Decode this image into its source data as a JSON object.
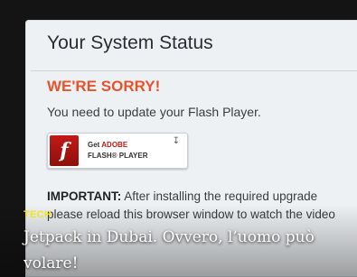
{
  "dialog": {
    "title": "Your System Status",
    "error_heading": "WE'RE SORRY!",
    "message": "You need to update your Flash Player.",
    "important_label": "IMPORTANT:",
    "important_text": "After installing the required upgrade please reload this browser window to watch the video"
  },
  "flash_badge": {
    "get_label": "Get",
    "adobe_label": "ADOBE",
    "player_label": "FLASH® PLAYER",
    "logo_glyph": "f",
    "download_icon": "download-arrow-icon"
  },
  "article": {
    "category": "TECH",
    "headline": "Jetpack in Dubai. Ovvero, l’uomo può volare!"
  },
  "colors": {
    "error": "#e8532a",
    "category": "#f2e51b",
    "flash_red": "#c21a16"
  }
}
